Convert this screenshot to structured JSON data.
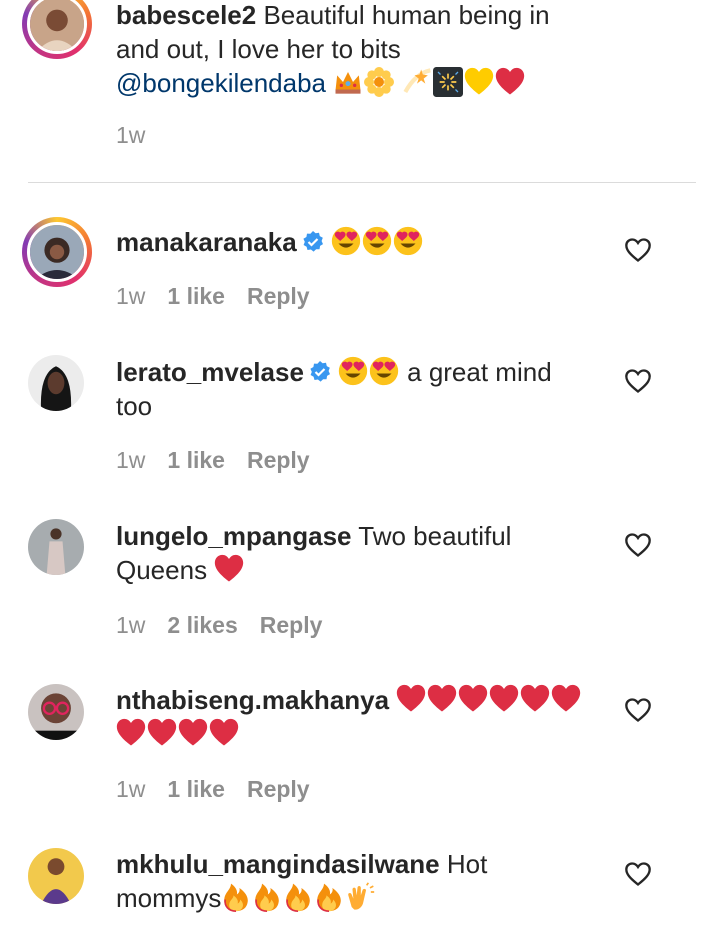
{
  "comments": [
    {
      "username": "babescele2",
      "text": " Beautiful human being in and out, I love her to bits ",
      "mention": "@bongekilendaba",
      "time": "1w",
      "likes": "",
      "reply": ""
    },
    {
      "username": "manakaranaka",
      "text": "",
      "time": "1w",
      "likes": "1 like",
      "reply": "Reply"
    },
    {
      "username": "lerato_mvelase",
      "text": " a great mind too",
      "time": "1w",
      "likes": "1 like",
      "reply": "Reply"
    },
    {
      "username": "lungelo_mpangase",
      "text": " Two beautiful Queens ",
      "time": "1w",
      "likes": "2 likes",
      "reply": "Reply"
    },
    {
      "username": "nthabiseng.makhanya",
      "text": "",
      "time": "1w",
      "likes": "1 like",
      "reply": "Reply"
    },
    {
      "username": "mkhulu_mangindasilwane",
      "text": " Hot mommys",
      "time": "",
      "likes": "",
      "reply": ""
    }
  ],
  "icons": {
    "verified": "verified-badge-icon",
    "like": "heart-outline-icon"
  },
  "colors": {
    "mention": "#00376b",
    "verified": "#3897f0",
    "meta": "#8e8e8e",
    "heart_emoji": "#e0245e"
  }
}
